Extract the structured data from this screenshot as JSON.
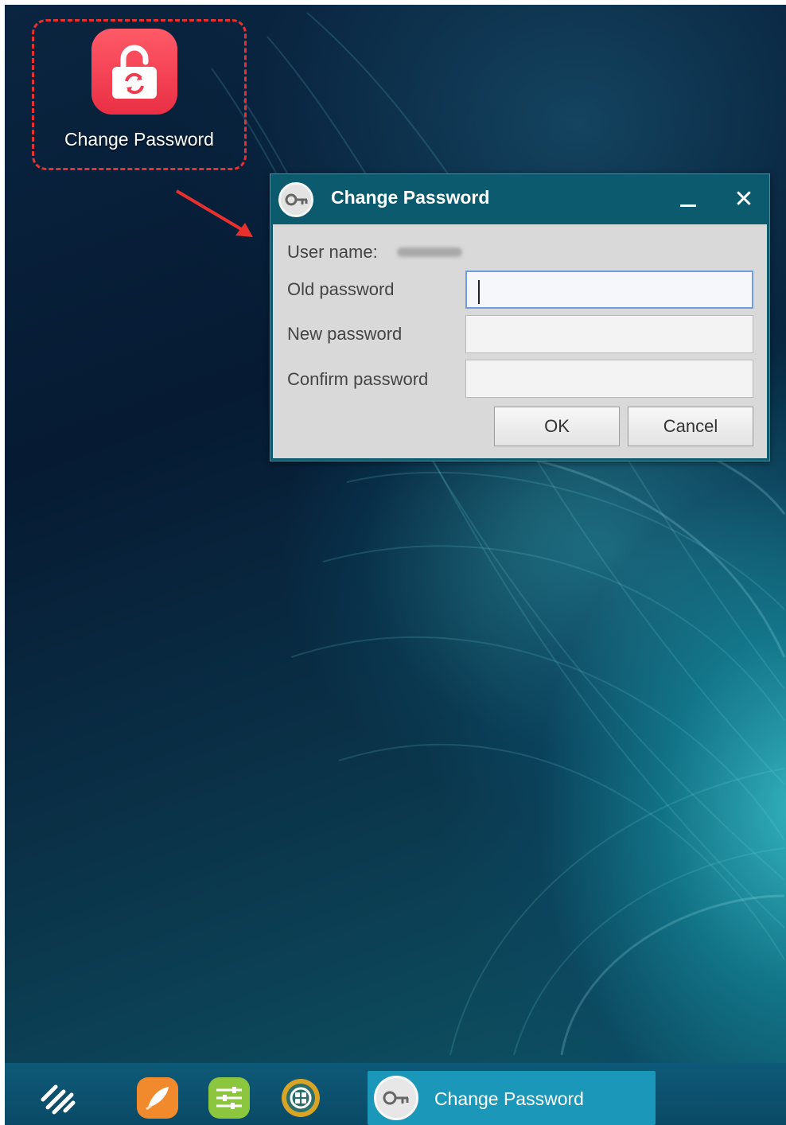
{
  "desktop": {
    "shortcut": {
      "label": "Change Password",
      "icon": "lock-refresh-icon",
      "tile_color": "#ef3b4e"
    },
    "highlight_color": "#e8312f"
  },
  "dialog": {
    "title": "Change Password",
    "title_icon": "key-icon",
    "minimize_symbol": "_",
    "close_symbol": "✕",
    "fields": {
      "username_label": "User name:",
      "old_password_label": "Old password",
      "new_password_label": "New password",
      "confirm_password_label": "Confirm password",
      "old_password_value": "",
      "new_password_value": "",
      "confirm_password_value": ""
    },
    "ok_label": "OK",
    "cancel_label": "Cancel"
  },
  "taskbar": {
    "items": [
      {
        "name": "start-menu",
        "icon": "start-logo-icon"
      },
      {
        "name": "launcher",
        "icon": "rocket-icon"
      },
      {
        "name": "settings",
        "icon": "sliders-icon"
      },
      {
        "name": "app-center",
        "icon": "grid-icon"
      }
    ],
    "active_window": {
      "label": "Change Password",
      "icon": "key-icon"
    }
  }
}
